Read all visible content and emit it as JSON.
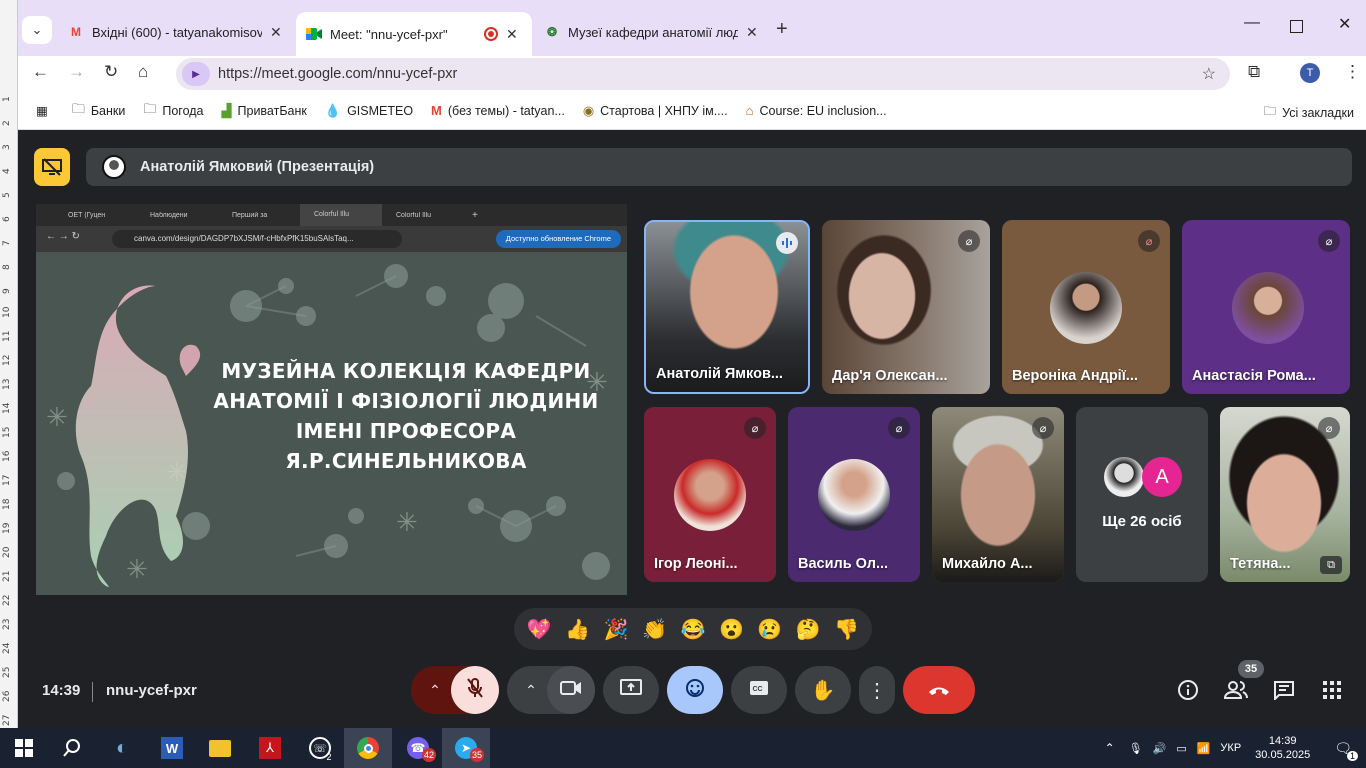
{
  "ruler_ticks": [
    "1",
    "2",
    "3",
    "4",
    "5",
    "6",
    "7",
    "8",
    "9",
    "10",
    "11",
    "12",
    "13",
    "14",
    "15",
    "16",
    "17",
    "18",
    "19",
    "20",
    "21",
    "22",
    "23",
    "24",
    "25",
    "26",
    "27"
  ],
  "browser": {
    "tabs": [
      {
        "title": "Вхідні (600) - tatyanakomisova@",
        "icon": "gmail-icon",
        "active": false
      },
      {
        "title": "Meet: \"nnu-ycef-pxr\"",
        "icon": "meet-icon",
        "active": true
      },
      {
        "title": "Музеї кафедри анатомії людин",
        "icon": "museum-icon",
        "active": false
      }
    ],
    "url": "https://meet.google.com/nnu-ycef-pxr",
    "profile_initial": "T",
    "bookmarks": [
      {
        "label": "Банки",
        "icon": "folder-icon"
      },
      {
        "label": "Погода",
        "icon": "folder-icon"
      },
      {
        "label": "ПриватБанк",
        "icon": "privatbank-icon"
      },
      {
        "label": "GISMETEO",
        "icon": "gismeteo-icon"
      },
      {
        "label": "(без темы) - tatyan...",
        "icon": "gmail-icon"
      },
      {
        "label": "Стартова | ХНПУ ім....",
        "icon": "hnpu-icon"
      },
      {
        "label": "Course: EU inclusion...",
        "icon": "course-icon"
      }
    ],
    "all_bookmarks": "Усі закладки"
  },
  "meet": {
    "presenter": "Анатолій Ямковий (Презентація)",
    "shared_screen": {
      "tabs": [
        "ОЕТ (Гуцен",
        "Наблюдени",
        "Перший за",
        "Colorful Illu",
        "Colorful Illu"
      ],
      "url": "canva.com/design/DAGDP7bXJSM/f-cHbfxPfK15buSAlsTaq...",
      "update_label": "Доступно обновление Chrome",
      "slide_title_lines": [
        "МУЗЕЙНА КОЛЕКЦІЯ КАФЕДРИ",
        "АНАТОМІЇ І ФІЗІОЛОГІЇ ЛЮДИНИ",
        "ІМЕНІ ПРОФЕСОРА",
        "Я.Р.СИНЕЛЬНИКОВА"
      ]
    },
    "participants": [
      {
        "name": "Анатолій Ямков...",
        "state": "speaking"
      },
      {
        "name": "Дар'я Олексан...",
        "state": "muted"
      },
      {
        "name": "Вероніка Андрії...",
        "state": "muted"
      },
      {
        "name": "Анастасія Рома...",
        "state": "muted"
      },
      {
        "name": "Ігор Леоні...",
        "state": "muted"
      },
      {
        "name": "Василь Ол...",
        "state": "muted"
      },
      {
        "name": "Михайло А...",
        "state": "muted"
      },
      {
        "name": "Тетяна...",
        "state": "muted"
      }
    ],
    "more_people": "Ще 26 осіб",
    "more_avatar_letter": "A",
    "reactions": [
      "💖",
      "👍",
      "🎉",
      "👏",
      "😂",
      "😮",
      "😢",
      "🤔",
      "👎"
    ],
    "time": "14:39",
    "meeting_code": "nnu-ycef-pxr",
    "participant_count": "35"
  },
  "taskbar": {
    "whatsapp_count": "2",
    "viber_count": "42",
    "telegram_count": "35",
    "language": "УКР",
    "time": "14:39",
    "date": "30.05.2025",
    "notifications": "1"
  },
  "colors": {
    "accent": "#8ab4f8",
    "end_call": "#ea4335",
    "presenter": "#fcc934",
    "chrome_bg": "#e8def8"
  }
}
